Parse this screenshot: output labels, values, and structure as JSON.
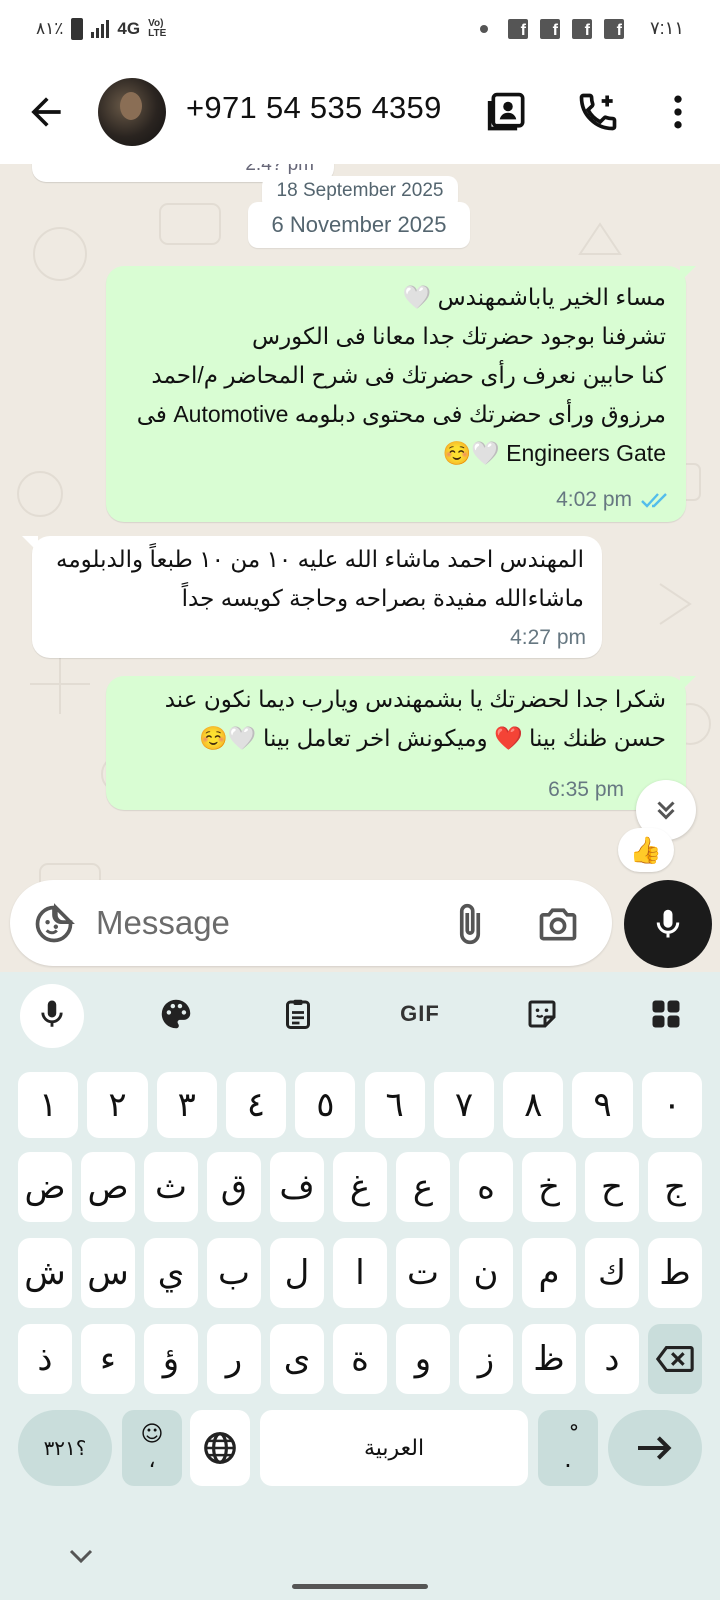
{
  "status_bar": {
    "battery": "٨١٪",
    "network": "4G",
    "volte": "Vo) LTE",
    "time": "٧:١١"
  },
  "header": {
    "contact_name": "+971 54 535 4359"
  },
  "chat": {
    "partial_time": "2:4? pm",
    "date_old": "18 September 2025",
    "date_current": "6 November 2025",
    "messages": [
      {
        "direction": "outgoing",
        "text": "مساء الخير ياباشمهندس 🤍\nتشرفنا بوجود حضرتك جدا معانا فى الكورس\nكنا حابين نعرف رأى حضرتك فى شرح المحاضر م/احمد\nمرزوق ورأى حضرتك فى محتوى دبلومه Automotive فى\nEngineers Gate 🤍☺️",
        "time": "4:02 pm",
        "status": "read"
      },
      {
        "direction": "incoming",
        "text": "المهندس احمد ماشاء الله عليه ١٠ من ١٠ طبعاً والدبلومه\nماشاءالله مفيدة بصراحه وحاجة كويسه جداً",
        "time": "4:27 pm"
      },
      {
        "direction": "outgoing",
        "text": "شكرا جدا لحضرتك يا بشمهندس ويارب ديما نكون عند\nحسن ظنك بينا ❤️ وميكونش اخر تعامل بينا 🤍☺️",
        "time": "6:35 pm",
        "reaction": "👍"
      }
    ]
  },
  "composer": {
    "placeholder": "Message"
  },
  "keyboard": {
    "toolbar_gif": "GIF",
    "row_digits": [
      "١",
      "٢",
      "٣",
      "٤",
      "٥",
      "٦",
      "٧",
      "٨",
      "٩",
      "٠"
    ],
    "row1": [
      "ض",
      "ص",
      "ث",
      "ق",
      "ف",
      "غ",
      "ع",
      "ه",
      "خ",
      "ح",
      "ج"
    ],
    "row2": [
      "ش",
      "س",
      "ي",
      "ب",
      "ل",
      "ا",
      "ت",
      "ن",
      "م",
      "ك",
      "ط"
    ],
    "row3": [
      "ذ",
      "ء",
      "ؤ",
      "ر",
      "ى",
      "ة",
      "و",
      "ز",
      "ظ",
      "د"
    ],
    "symbols_label": "؟٣٢١",
    "emoji_key_top": "☺",
    "emoji_key_bottom": "،",
    "space_label": "العربية",
    "period_top": "ْ",
    "period_bottom": "."
  },
  "colors": {
    "outgoing_bubble": "#d9fdd3",
    "incoming_bubble": "#ffffff",
    "chat_background": "#efeae2",
    "read_ticks": "#53bdeb",
    "keyboard_background": "#e3eeed"
  }
}
